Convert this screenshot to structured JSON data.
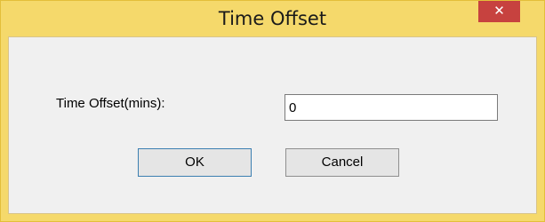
{
  "window": {
    "title": "Time Offset",
    "close_label": "✕"
  },
  "form": {
    "offset_label": "Time Offset(mins):",
    "offset_value": "0"
  },
  "buttons": {
    "ok_label": "OK",
    "cancel_label": "Cancel"
  },
  "colors": {
    "frame": "#f5d96b",
    "close": "#c7423f"
  }
}
